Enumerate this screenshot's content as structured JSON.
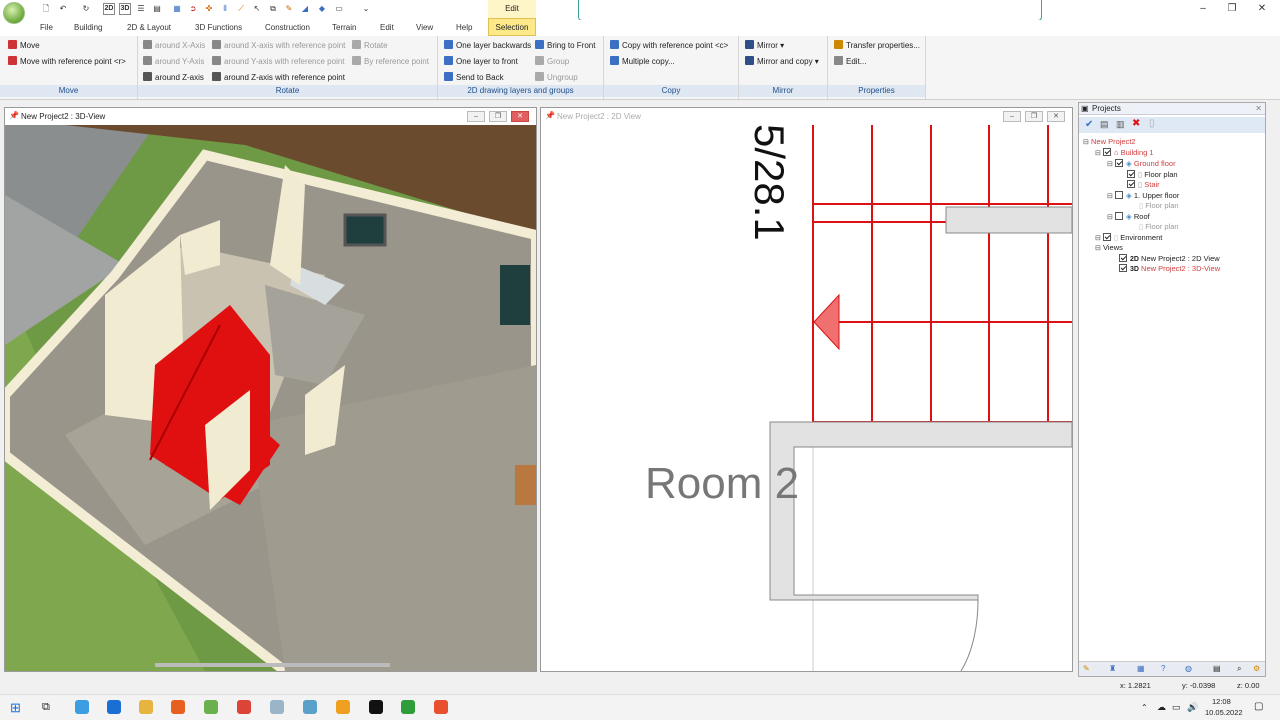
{
  "titlebar": {
    "context_tab_title": "Edit"
  },
  "menu": {
    "items": [
      "File",
      "Building",
      "2D & Layout",
      "3D Functions",
      "Construction",
      "Terrain",
      "Edit",
      "View",
      "Help"
    ],
    "active_tab": "Selection"
  },
  "ribbon": {
    "move": {
      "name": "Move",
      "move": "Move",
      "move_ref": "Move with reference point <r>"
    },
    "rotate": {
      "name": "Rotate",
      "x": "around X-Axis",
      "y": "around Y-Axis",
      "z": "around Z-axis",
      "x_ref": "around X-axis with reference point",
      "y_ref": "around Y-axis with reference point",
      "z_ref": "around Z-axis with reference point",
      "rotate": "Rotate",
      "by_ref": "By reference point"
    },
    "layers": {
      "name": "2D drawing layers and groups",
      "backwards": "One layer backwards",
      "front": "One layer to front",
      "send_back": "Send to Back",
      "bring_front": "Bring to Front",
      "group": "Group",
      "ungroup": "Ungroup"
    },
    "copy": {
      "name": "Copy",
      "copy_ref": "Copy with reference point <c>",
      "multiple": "Multiple copy..."
    },
    "mirror": {
      "name": "Mirror",
      "mirror": "Mirror",
      "mirror_copy": "Mirror and copy"
    },
    "properties": {
      "name": "Properties",
      "transfer": "Transfer properties...",
      "edit": "Edit..."
    }
  },
  "view3d": {
    "title": "New Project2 : 3D-View"
  },
  "view2d": {
    "title": "New Project2 : 2D View",
    "dimension_text": "5/28.1",
    "room_label": "Room 2"
  },
  "projects": {
    "title": "Projects",
    "tree": [
      {
        "label": "New Project2",
        "level": 0,
        "color": "#d04040",
        "checked": null
      },
      {
        "label": "Building 1",
        "level": 1,
        "color": "#d04040",
        "checked": true
      },
      {
        "label": "Ground floor",
        "level": 2,
        "color": "#d04040",
        "checked": true
      },
      {
        "label": "Floor plan",
        "level": 3,
        "color": "#222222",
        "checked": true
      },
      {
        "label": "Stair",
        "level": 3,
        "color": "#d04040",
        "checked": true
      },
      {
        "label": "1. Upper floor",
        "level": 2,
        "color": "#222222",
        "checked": false
      },
      {
        "label": "Floor plan",
        "level": 3,
        "color": "#999999",
        "checked": null
      },
      {
        "label": "Roof",
        "level": 2,
        "color": "#222222",
        "checked": false
      },
      {
        "label": "Floor plan",
        "level": 3,
        "color": "#999999",
        "checked": null
      },
      {
        "label": "Environment",
        "level": 1,
        "color": "#222222",
        "checked": true
      },
      {
        "label": "Views",
        "level": 0,
        "color": "#222222",
        "checked": null
      },
      {
        "label": "New Project2 : 2D View",
        "level": 1,
        "color": "#222222",
        "checked": true,
        "badge": "2D"
      },
      {
        "label": "New Project2 : 3D-View",
        "level": 1,
        "color": "#d04040",
        "checked": true,
        "badge": "3D"
      }
    ]
  },
  "status": {
    "x": "x: 1.2821",
    "y": "y: -0.0398",
    "z": "z: 0.00"
  },
  "taskbar": {
    "time": "12:08",
    "date": "10.05.2022"
  }
}
